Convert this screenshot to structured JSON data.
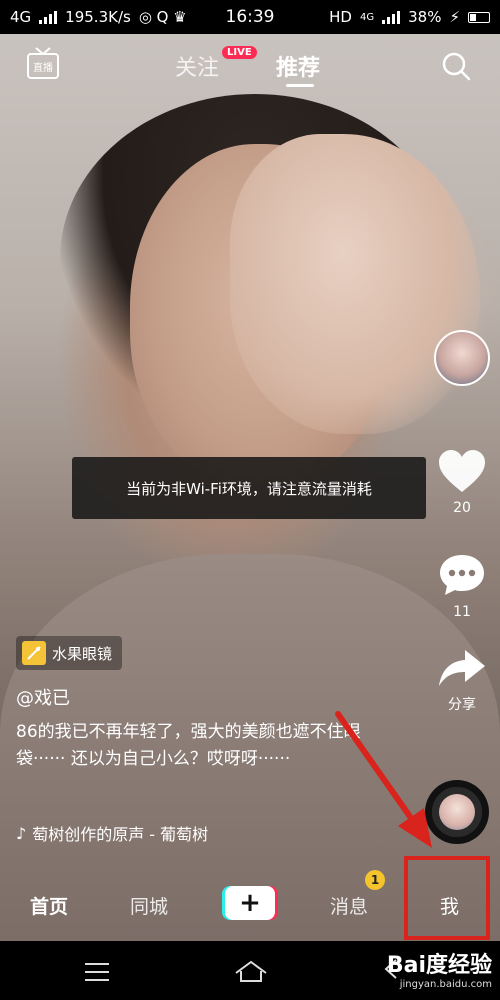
{
  "status_bar": {
    "network": "4G",
    "speed": "195.3K/s",
    "time": "16:39",
    "hd": "HD",
    "network_right": "4G",
    "battery": "38%"
  },
  "top_nav": {
    "follow": "关注",
    "live_badge": "LIVE",
    "recommend": "推荐",
    "live_icon_label": "直播"
  },
  "toast": {
    "text": "当前为非Wi-Fi环境，请注意流量消耗"
  },
  "side_actions": {
    "like_count": "20",
    "comment_count": "11",
    "share_label": "分享"
  },
  "post": {
    "filter_tag": "水果眼镜",
    "author": "@戏已",
    "description": "86的我已不再年轻了，强大的美颜也遮不住眼袋······  还以为自己小么？哎呀呀······",
    "music": "萄树创作的原声 - 葡萄树"
  },
  "tab_bar": {
    "home": "首页",
    "city": "同城",
    "add": "+",
    "messages": "消息",
    "messages_badge": "1",
    "me": "我"
  },
  "watermark": {
    "logo": "Bai度经验",
    "url": "jingyan.baidu.com"
  },
  "colors": {
    "accent": "#fe2c55",
    "cyan": "#2bf0ea",
    "annotation_red": "#d9241d",
    "badge_yellow": "#f5c32c"
  }
}
